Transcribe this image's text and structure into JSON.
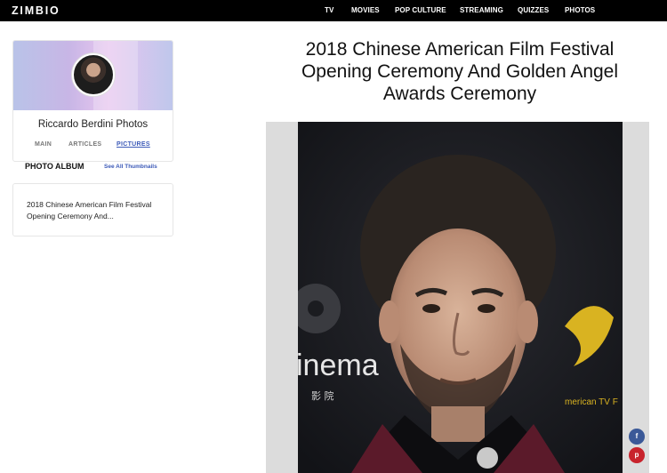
{
  "site": {
    "logo": "ZIMBIO"
  },
  "nav": {
    "items": [
      "TV",
      "MOVIES",
      "POP CULTURE",
      "STREAMING",
      "QUIZZES",
      "PHOTOS"
    ]
  },
  "profile": {
    "name": "Riccardo Berdini Photos",
    "tabs": [
      "MAIN",
      "ARTICLES",
      "PICTURES"
    ],
    "active_tab": "PICTURES"
  },
  "album": {
    "heading": "PHOTO ALBUM",
    "see_all": "See All Thumbnails",
    "item_title": "2018 Chinese American Film Festival Opening Ceremony And..."
  },
  "article": {
    "title": "2018 Chinese American Film Festival Opening Ceremony And Golden Angel Awards Ceremony"
  },
  "photo": {
    "backdrop_text": "inema",
    "backdrop_sub": "影 院",
    "backdrop_right": "merican TV F"
  },
  "share": {
    "facebook": "f",
    "pinterest": "p"
  },
  "colors": {
    "accent": "#3c5ab8",
    "facebook": "#3b5998",
    "pinterest": "#c8232c",
    "topbar": "#000000"
  }
}
